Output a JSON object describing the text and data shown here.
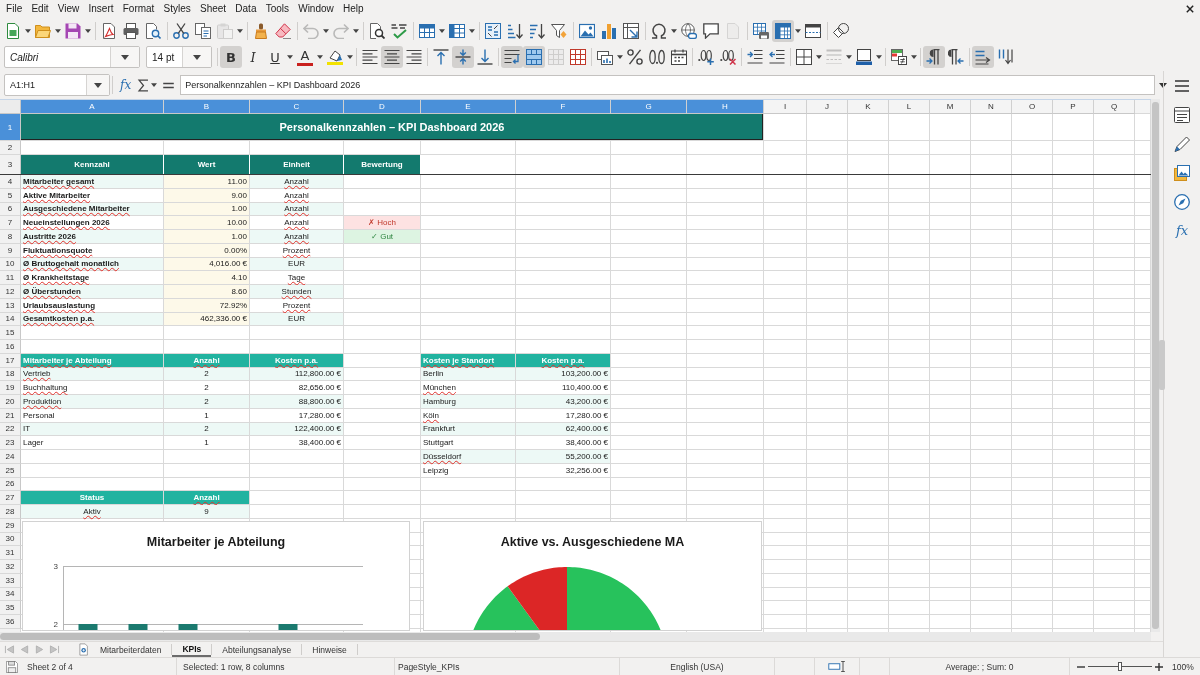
{
  "menu_bar": {
    "items": [
      "File",
      "Edit",
      "View",
      "Insert",
      "Format",
      "Styles",
      "Sheet",
      "Data",
      "Tools",
      "Window",
      "Help"
    ]
  },
  "standard_toolbar": {
    "paste": {
      "disabled": true
    },
    "undo": {
      "disabled": true
    },
    "redo": {
      "disabled": true
    },
    "header_footer": {
      "disabled": true
    },
    "freeze": {
      "pressed": true
    }
  },
  "formatting_toolbar": {
    "font_name": "Calibri",
    "font_size": "14 pt",
    "bold": {
      "label": "B",
      "pressed": true
    },
    "italic": {
      "label": "I",
      "pressed": false
    },
    "underline": {
      "label": "U",
      "pressed": false
    },
    "font_color": {
      "label": "A"
    },
    "align_left": {
      "pressed": false
    },
    "align_center": {
      "pressed": true
    },
    "align_right": {
      "pressed": false
    },
    "align_top": {
      "pressed": false
    },
    "align_middle": {
      "pressed": true
    },
    "align_bottom": {
      "pressed": false
    },
    "wrap_text": {
      "pressed": true
    },
    "merge_center": {
      "pressed": true
    },
    "unmerge": {
      "disabled": true
    },
    "border_style": {
      "disabled": true
    },
    "left_to_right": {
      "pressed": true
    },
    "right_to_left": {
      "pressed": false
    },
    "text_left_to_right": {
      "pressed": true
    },
    "text_top_to_bottom": {
      "pressed": false
    }
  },
  "formula_bar": {
    "name_box": "A1:H1",
    "function_wizard": "fx",
    "content": "Personalkennzahlen – KPI Dashboard 2026"
  },
  "sheet": {
    "columns": [
      {
        "label": "A",
        "selected": true
      },
      {
        "label": "B",
        "selected": true
      },
      {
        "label": "C",
        "selected": true
      },
      {
        "label": "D",
        "selected": true
      },
      {
        "label": "E",
        "selected": true
      },
      {
        "label": "F",
        "selected": true
      },
      {
        "label": "G",
        "selected": true
      },
      {
        "label": "H",
        "selected": true
      },
      {
        "label": "I",
        "selected": false
      },
      {
        "label": "J",
        "selected": false
      },
      {
        "label": "K",
        "selected": false
      },
      {
        "label": "L",
        "selected": false
      },
      {
        "label": "M",
        "selected": false
      },
      {
        "label": "N",
        "selected": false
      },
      {
        "label": "O",
        "selected": false
      },
      {
        "label": "P",
        "selected": false
      },
      {
        "label": "Q",
        "selected": false
      }
    ],
    "frozen_rows": [
      {
        "number": "1",
        "selected": true
      },
      {
        "number": "2",
        "selected": false
      },
      {
        "number": "3",
        "selected": false
      }
    ],
    "rows": [
      {
        "number": "4",
        "selected": false
      },
      {
        "number": "5",
        "selected": false
      },
      {
        "number": "6",
        "selected": false
      },
      {
        "number": "7",
        "selected": false
      },
      {
        "number": "8",
        "selected": false
      },
      {
        "number": "9",
        "selected": false
      },
      {
        "number": "10",
        "selected": false
      },
      {
        "number": "11",
        "selected": false
      },
      {
        "number": "12",
        "selected": false
      },
      {
        "number": "13",
        "selected": false
      },
      {
        "number": "14",
        "selected": false
      },
      {
        "number": "15",
        "selected": false
      },
      {
        "number": "16",
        "selected": false
      },
      {
        "number": "17",
        "selected": false
      },
      {
        "number": "18",
        "selected": false
      },
      {
        "number": "19",
        "selected": false
      },
      {
        "number": "20",
        "selected": false
      },
      {
        "number": "21",
        "selected": false
      },
      {
        "number": "22",
        "selected": false
      },
      {
        "number": "23",
        "selected": false
      },
      {
        "number": "24",
        "selected": false
      },
      {
        "number": "25",
        "selected": false
      },
      {
        "number": "26",
        "selected": false
      },
      {
        "number": "27",
        "selected": false
      },
      {
        "number": "28",
        "selected": false
      },
      {
        "number": "29",
        "selected": false
      },
      {
        "number": "30",
        "selected": false
      },
      {
        "number": "31",
        "selected": false
      },
      {
        "number": "32",
        "selected": false
      },
      {
        "number": "33",
        "selected": false
      },
      {
        "number": "34",
        "selected": false
      },
      {
        "number": "35",
        "selected": false
      },
      {
        "number": "36",
        "selected": false
      }
    ],
    "title": "Personalkennzahlen – KPI Dashboard 2026",
    "kpi_table": {
      "headers": [
        {
          "text": "Kennzahl",
          "misspelled": false
        },
        {
          "text": "Wert",
          "misspelled": false
        },
        {
          "text": "Einheit",
          "misspelled": false
        },
        {
          "text": "Bewertung",
          "misspelled": false
        }
      ],
      "rows": [
        {
          "label": "Mitarbeiter gesamt",
          "label_misspelled": true,
          "value": "11.00",
          "unit": "Anzahl",
          "unit_misspelled": true
        },
        {
          "label": "Aktive Mitarbeiter",
          "label_misspelled": true,
          "value": "9.00",
          "unit": "Anzahl",
          "unit_misspelled": true
        },
        {
          "label": "Ausgeschiedene Mitarbeiter",
          "label_misspelled": true,
          "value": "1.00",
          "unit": "Anzahl",
          "unit_misspelled": true
        },
        {
          "label": "Neueinstellungen 2026",
          "label_misspelled": true,
          "value": "10.00",
          "unit": "Anzahl",
          "unit_misspelled": true,
          "rating": "✗ Hoch",
          "rating_positive": false
        },
        {
          "label": "Austritte 2026",
          "label_misspelled": true,
          "value": "1.00",
          "unit": "Anzahl",
          "unit_misspelled": true,
          "rating": "✓ Gut",
          "rating_positive": true
        },
        {
          "label": "Fluktuationsquote",
          "label_misspelled": true,
          "value": "0.00%",
          "unit": "Prozent",
          "unit_misspelled": true
        },
        {
          "label": "Ø Bruttogehalt monatlich",
          "label_misspelled": true,
          "value": "4,016.00 €",
          "unit": "EUR",
          "unit_misspelled": false
        },
        {
          "label": "Ø Krankheitstage",
          "label_misspelled": true,
          "value": "4.10",
          "unit": "Tage",
          "unit_misspelled": true
        },
        {
          "label": "Ø Überstunden",
          "label_misspelled": true,
          "value": "8.60",
          "unit": "Stunden",
          "unit_misspelled": true
        },
        {
          "label": "Urlaubsauslastung",
          "label_misspelled": true,
          "value": "72.92%",
          "unit": "Prozent",
          "unit_misspelled": true
        },
        {
          "label": "Gesamtkosten p.a.",
          "label_misspelled": true,
          "value": "462,336.00 €",
          "unit": "EUR",
          "unit_misspelled": false
        }
      ]
    },
    "department_table": {
      "headers": [
        {
          "text": "Mitarbeiter je Abteilung",
          "misspelled": true
        },
        {
          "text": "Anzahl",
          "misspelled": true
        },
        {
          "text": "Kosten p.a.",
          "misspelled": true
        }
      ],
      "rows": [
        {
          "name": "Vertrieb",
          "name_misspelled": true,
          "count": "2",
          "cost": "112,800.00 €"
        },
        {
          "name": "Buchhaltung",
          "name_misspelled": true,
          "count": "2",
          "cost": "82,656.00 €"
        },
        {
          "name": "Produktion",
          "name_misspelled": true,
          "count": "2",
          "cost": "88,800.00 €"
        },
        {
          "name": "Personal",
          "name_misspelled": false,
          "count": "1",
          "cost": "17,280.00 €"
        },
        {
          "name": "IT",
          "name_misspelled": false,
          "count": "2",
          "cost": "122,400.00 €"
        },
        {
          "name": "Lager",
          "name_misspelled": false,
          "count": "1",
          "cost": "38,400.00 €"
        }
      ]
    },
    "location_table": {
      "headers": [
        {
          "text": "Kosten je Standort",
          "misspelled": true
        },
        {
          "text": "Kosten p.a.",
          "misspelled": true
        }
      ],
      "rows": [
        {
          "city": "Berlin",
          "city_misspelled": false,
          "cost": "103,200.00 €"
        },
        {
          "city": "München",
          "city_misspelled": true,
          "cost": "110,400.00 €"
        },
        {
          "city": "Hamburg",
          "city_misspelled": false,
          "cost": "43,200.00 €"
        },
        {
          "city": "Köln",
          "city_misspelled": true,
          "cost": "17,280.00 €"
        },
        {
          "city": "Frankfurt",
          "city_misspelled": false,
          "cost": "62,400.00 €"
        },
        {
          "city": "Stuttgart",
          "city_misspelled": false,
          "cost": "38,400.00 €"
        },
        {
          "city": "Düsseldorf",
          "city_misspelled": true,
          "cost": "55,200.00 €"
        },
        {
          "city": "Leipzig",
          "city_misspelled": false,
          "cost": "32,256.00 €"
        }
      ]
    },
    "status_table": {
      "headers": [
        {
          "text": "Status",
          "misspelled": false
        },
        {
          "text": "Anzahl",
          "misspelled": true
        }
      ],
      "rows": [
        {
          "status": "Aktiv",
          "status_misspelled": true,
          "count": "9"
        }
      ]
    },
    "charts": [
      {
        "kind": "bar",
        "title": "Mitarbeiter je Abteilung",
        "axis_labels": [
          "3",
          "2"
        ]
      },
      {
        "kind": "pie",
        "title": "Aktive vs. Ausgeschiedene MA"
      }
    ]
  },
  "sheet_tabs": [
    {
      "label": "Mitarbeiterdaten",
      "selected": false
    },
    {
      "label": "KPIs",
      "selected": true
    },
    {
      "label": "Abteilungsanalyse",
      "selected": false
    },
    {
      "label": "Hinweise",
      "selected": false
    }
  ],
  "sidebar": {
    "functions": "fx"
  },
  "status_bar": {
    "sheet": "Sheet 2 of 4",
    "selection": "Selected: 1 row, 8 columns",
    "page_style": "PageStyle_KPIs",
    "language": "English (USA)",
    "summary": "Average: ; Sum: 0",
    "zoom": {
      "level": 0.5,
      "label": "100%"
    }
  }
}
